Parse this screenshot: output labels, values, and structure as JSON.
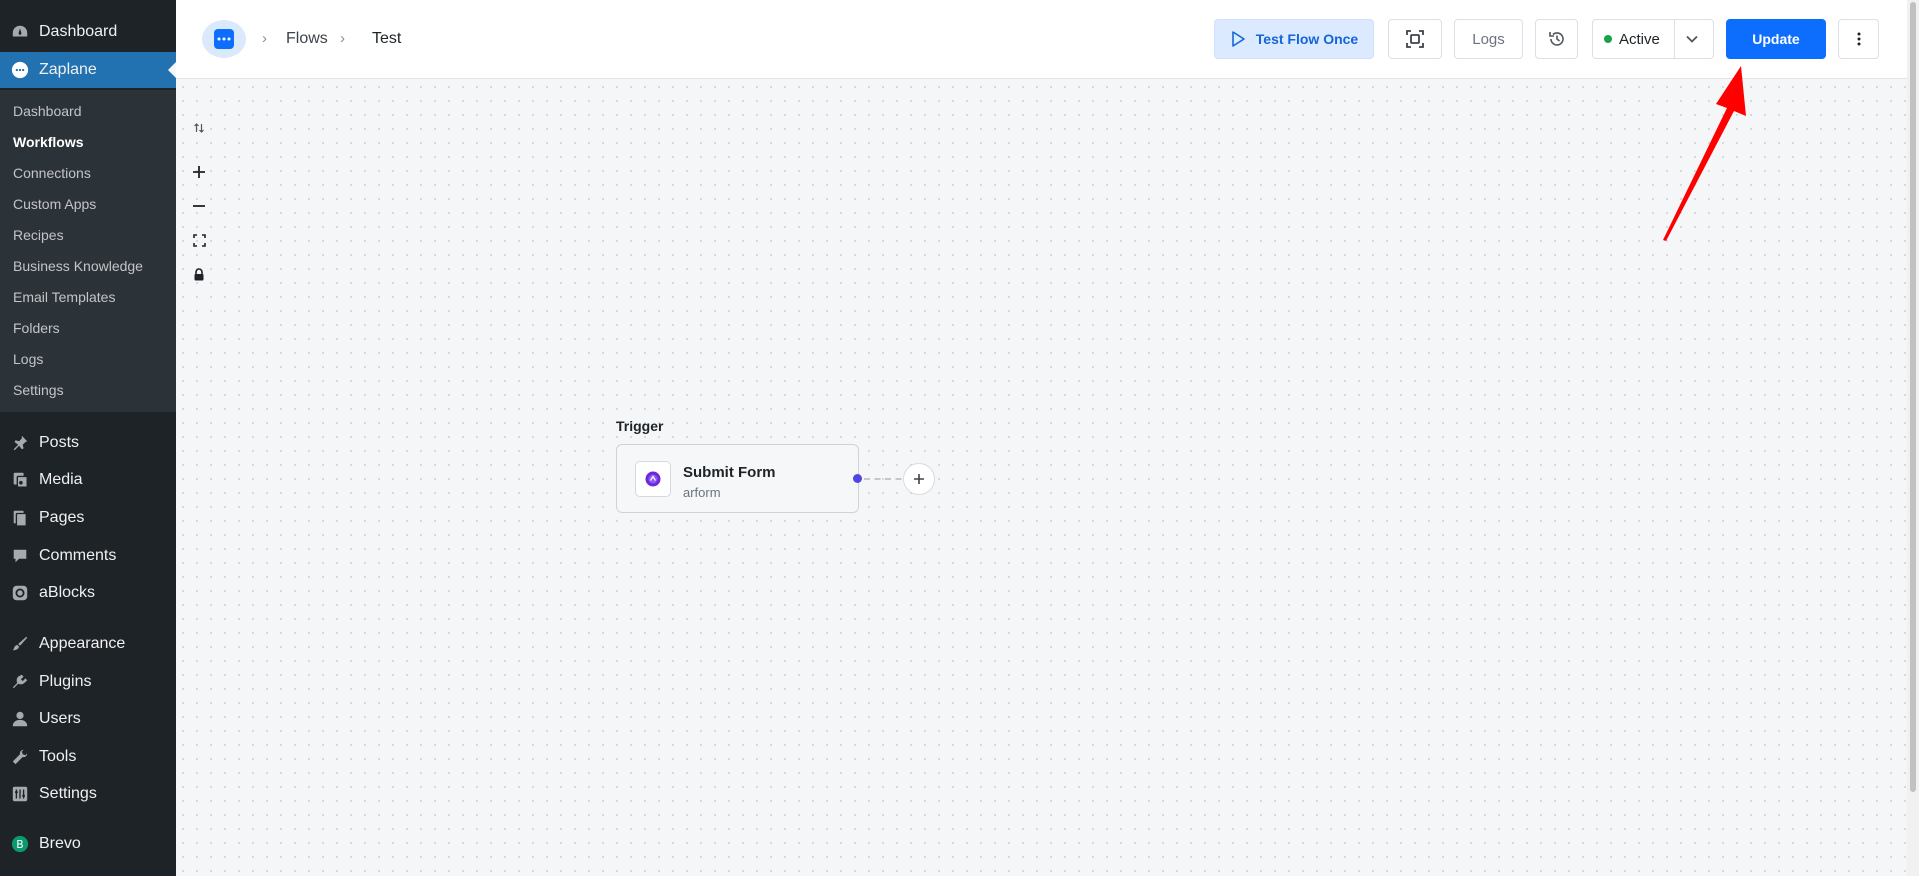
{
  "sidebar": {
    "top_items": [
      {
        "label": "Dashboard",
        "icon": "dashboard-icon"
      },
      {
        "label": "Zaplane",
        "icon": "zaplane-icon",
        "current": true
      }
    ],
    "submenu": [
      {
        "label": "Dashboard"
      },
      {
        "label": "Workflows",
        "active": true
      },
      {
        "label": "Connections"
      },
      {
        "label": "Custom Apps"
      },
      {
        "label": "Recipes"
      },
      {
        "label": "Business Knowledge"
      },
      {
        "label": "Email Templates"
      },
      {
        "label": "Folders"
      },
      {
        "label": "Logs"
      },
      {
        "label": "Settings"
      }
    ],
    "items": [
      {
        "label": "Posts",
        "icon": "pushpin-icon"
      },
      {
        "label": "Media",
        "icon": "media-icon"
      },
      {
        "label": "Pages",
        "icon": "pages-icon"
      },
      {
        "label": "Comments",
        "icon": "comment-icon"
      },
      {
        "label": "aBlocks",
        "icon": "ablocks-icon"
      },
      {
        "label": "Appearance",
        "icon": "paintbrush-icon"
      },
      {
        "label": "Plugins",
        "icon": "plugin-icon"
      },
      {
        "label": "Users",
        "icon": "user-icon"
      },
      {
        "label": "Tools",
        "icon": "wrench-icon"
      },
      {
        "label": "Settings",
        "icon": "settings-icon"
      },
      {
        "label": "Brevo",
        "icon": "brevo-icon"
      }
    ]
  },
  "header": {
    "breadcrumb": [
      "Flows",
      "Test"
    ],
    "test_flow_label": "Test Flow Once",
    "logs_label": "Logs",
    "status_label": "Active",
    "update_label": "Update"
  },
  "canvas": {
    "trigger_label": "Trigger",
    "node": {
      "title": "Submit Form",
      "subtitle": "arform"
    }
  },
  "colors": {
    "sidebar_bg": "#1d2327",
    "accent": "#2271b1",
    "primary": "#0d6efd",
    "status_active": "#16a34a",
    "annotation_arrow": "#ff0000"
  }
}
